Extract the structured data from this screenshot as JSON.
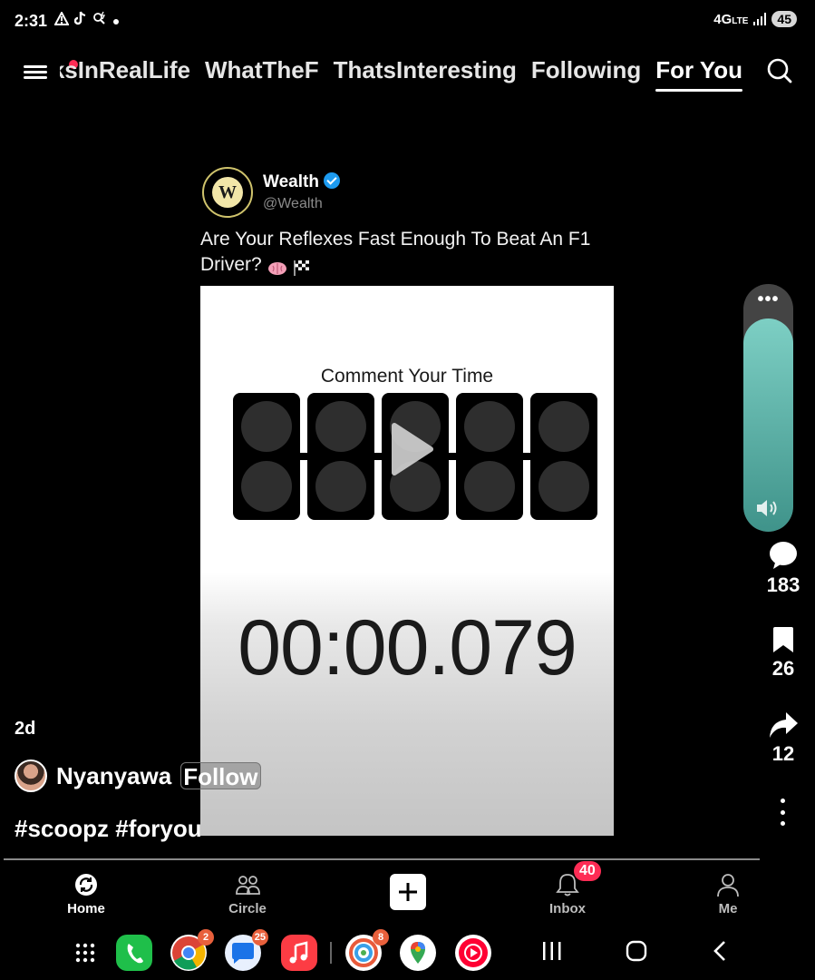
{
  "status_bar": {
    "time": "2:31",
    "icons": [
      "warning-icon",
      "tiktok-icon",
      "search-bolt-icon",
      "dot-icon"
    ],
    "network": "4G",
    "network_sub": "LTE",
    "battery": "45"
  },
  "top_nav": {
    "tabs": [
      {
        "label": "TikTokInRealLife",
        "visible_label": "ksInRealLife"
      },
      {
        "label": "WhatTheF"
      },
      {
        "label": "ThatsInteresting"
      },
      {
        "label": "Following"
      },
      {
        "label": "For You",
        "active": true
      }
    ]
  },
  "post": {
    "account_name": "Wealth",
    "account_handle": "@Wealth",
    "avatar_letter": "W",
    "caption": "Are Your Reflexes Fast Enough To Beat An F1 Driver?",
    "caption_emojis": [
      "brain-emoji",
      "checkered-flag-emoji"
    ]
  },
  "video": {
    "title": "Comment Your Time",
    "timer": "00:00.079",
    "lights_count": 5
  },
  "rail": {
    "volume_level": 0.86,
    "comments": "183",
    "bookmarks": "26",
    "shares": "12"
  },
  "overlay": {
    "age": "2d",
    "username": "Nyanyawa",
    "follow_label": "Follow",
    "hashtags": "#scoopz #foryou"
  },
  "bottom_nav": {
    "home": "Home",
    "circle": "Circle",
    "inbox": "Inbox",
    "inbox_badge": "40",
    "me": "Me"
  },
  "dock": {
    "chrome_badge": "2",
    "messages_badge": "25",
    "photos_badge": "8"
  },
  "colors": {
    "accent_red": "#fe2c55",
    "volume_teal": "#5fb8ae",
    "verified_blue": "#1d9bf0"
  }
}
